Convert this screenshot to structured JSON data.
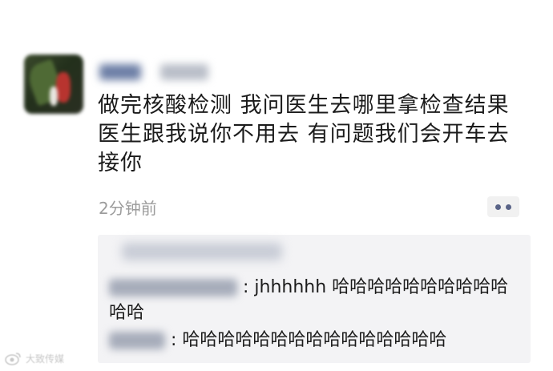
{
  "post": {
    "avatar_icon": "user-avatar-icon",
    "author_name": "",
    "author_tag": "",
    "text_lines": [
      "做完核酸检测 我问医生去哪里拿检查结果",
      "医生跟我说你不用去 有问题我们会开车去",
      "接你"
    ],
    "time": "2分钟前",
    "more_icon": "more-dots-icon"
  },
  "comments": [
    {
      "author": "",
      "text": ":  jhhhhhh 哈哈哈哈哈哈哈哈哈哈哈哈"
    },
    {
      "author": "",
      "text": ": 哈哈哈哈哈哈哈哈哈哈哈哈哈哈哈"
    }
  ],
  "watermark": {
    "text": "大致传媒",
    "icon": "weibo-logo-icon"
  },
  "colors": {
    "time_gray": "#9c9c9c",
    "dot_blue": "#596387",
    "comment_bg": "#f3f3f5"
  }
}
